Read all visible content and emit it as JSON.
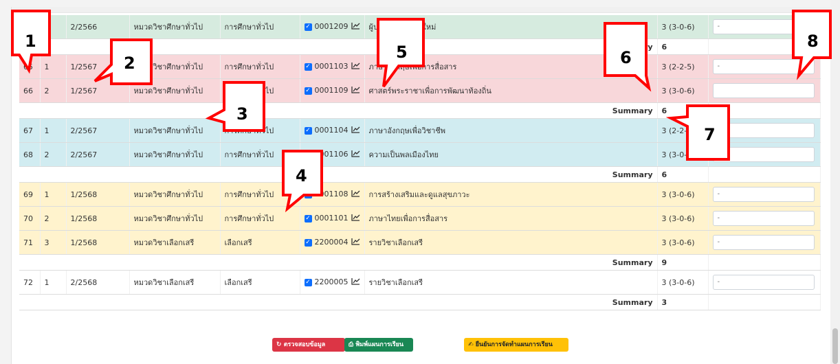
{
  "rows": [
    {
      "type": "course",
      "color": "green",
      "no": "",
      "seq": "",
      "term": "2/2566",
      "group": "หมวดวิชาศึกษาทั่วไป",
      "category": "การศึกษาทั่วไป",
      "code": "0001209",
      "name": "ผู้ประกอบการยุคใหม่",
      "credit": "3 (3-0-6)",
      "plan": "-"
    },
    {
      "type": "summary",
      "label": "Summary",
      "value": "6"
    },
    {
      "type": "course",
      "color": "pink",
      "no": "65",
      "seq": "1",
      "term": "1/2567",
      "group": "หมวดวิชาศึกษาทั่วไป",
      "category": "การศึกษาทั่วไป",
      "code": "0001103",
      "name": "ภาษาอังกฤษเพื่อการสื่อสาร",
      "credit": "3 (2-2-5)",
      "plan": "-"
    },
    {
      "type": "course",
      "color": "pink",
      "no": "66",
      "seq": "2",
      "term": "1/2567",
      "group": "หมวดวิชาศึกษาทั่วไป",
      "category": "การศึกษาทั่วไป",
      "code": "0001109",
      "name": "ศาสตร์พระราชาเพื่อการพัฒนาท้องถิ่น",
      "credit": "3 (3-0-6)",
      "plan": ""
    },
    {
      "type": "summary",
      "label": "Summary",
      "value": "6"
    },
    {
      "type": "course",
      "color": "blue",
      "no": "67",
      "seq": "1",
      "term": "2/2567",
      "group": "หมวดวิชาศึกษาทั่วไป",
      "category": "การศึกษาทั่วไป",
      "code": "0001104",
      "name": "ภาษาอังกฤษเพื่อวิชาชีพ",
      "credit": "3 (2-2-5)",
      "plan": ""
    },
    {
      "type": "course",
      "color": "blue",
      "no": "68",
      "seq": "2",
      "term": "2/2567",
      "group": "หมวดวิชาศึกษาทั่วไป",
      "category": "การศึกษาทั่วไป",
      "code": "0001106",
      "name": "ความเป็นพลเมืองไทย",
      "credit": "3 (3-0-6)",
      "plan": "-"
    },
    {
      "type": "summary",
      "label": "Summary",
      "value": "6"
    },
    {
      "type": "course",
      "color": "yellow",
      "no": "69",
      "seq": "1",
      "term": "1/2568",
      "group": "หมวดวิชาศึกษาทั่วไป",
      "category": "การศึกษาทั่วไป",
      "code": "0001108",
      "name": "การสร้างเสริมและดูแลสุขภาวะ",
      "credit": "3 (3-0-6)",
      "plan": "-"
    },
    {
      "type": "course",
      "color": "yellow",
      "no": "70",
      "seq": "2",
      "term": "1/2568",
      "group": "หมวดวิชาศึกษาทั่วไป",
      "category": "การศึกษาทั่วไป",
      "code": "0001101",
      "name": "ภาษาไทยเพื่อการสื่อสาร",
      "credit": "3 (3-0-6)",
      "plan": "-"
    },
    {
      "type": "course",
      "color": "yellow",
      "no": "71",
      "seq": "3",
      "term": "1/2568",
      "group": "หมวดวิชาเลือกเสรี",
      "category": "เลือกเสรี",
      "code": "2200004",
      "name": "รายวิชาเลือกเสรี",
      "credit": "3 (3-0-6)",
      "plan": "-"
    },
    {
      "type": "summary",
      "label": "Summary",
      "value": "9"
    },
    {
      "type": "course",
      "color": "white",
      "no": "72",
      "seq": "1",
      "term": "2/2568",
      "group": "หมวดวิชาเลือกเสรี",
      "category": "เลือกเสรี",
      "code": "2200005",
      "name": "รายวิชาเลือกเสรี",
      "credit": "3 (3-0-6)",
      "plan": "-"
    },
    {
      "type": "summary",
      "label": "Summary",
      "value": "3"
    }
  ],
  "buttons": {
    "check": "ตรวจสอบข้อมูล",
    "print": "พิมพ์แผนการเรียน",
    "confirm": "ยืนยันการจัดทำแผนการเรียน"
  },
  "callouts": [
    "1",
    "2",
    "3",
    "4",
    "5",
    "6",
    "7",
    "8"
  ],
  "colors": {
    "green": "#d6ebdf",
    "pink": "#f8d7da",
    "blue": "#d1ecf1",
    "yellow": "#fff3cd",
    "callout_border": "#ff0000"
  }
}
